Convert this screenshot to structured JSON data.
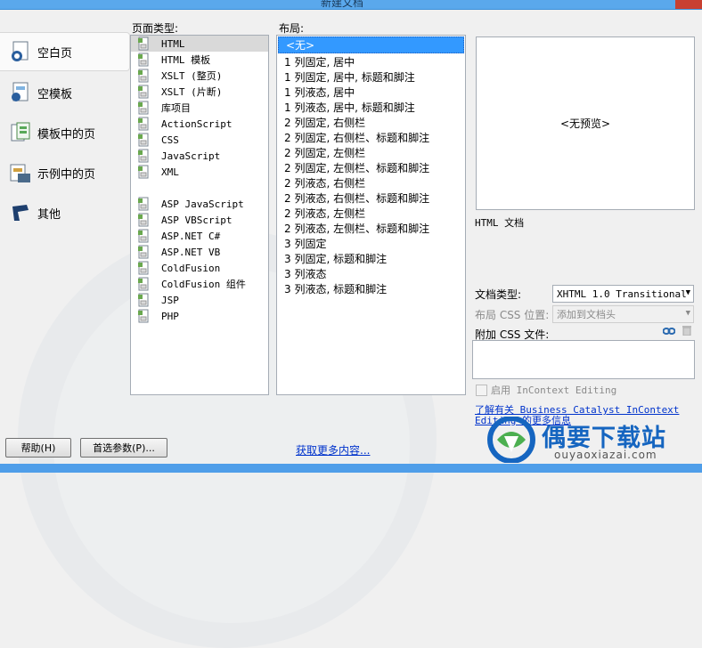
{
  "window": {
    "title": "新建文档"
  },
  "sidebar": {
    "items": [
      {
        "label": "空白页",
        "icon": "blank-page-icon"
      },
      {
        "label": "空模板",
        "icon": "empty-template-icon"
      },
      {
        "label": "模板中的页",
        "icon": "page-from-template-icon"
      },
      {
        "label": "示例中的页",
        "icon": "page-from-sample-icon"
      },
      {
        "label": "其他",
        "icon": "other-icon"
      }
    ]
  },
  "page_type": {
    "label": "页面类型:",
    "items": [
      "HTML",
      "HTML 模板",
      "XSLT (整页)",
      "XSLT (片断)",
      "库项目",
      "ActionScript",
      "CSS",
      "JavaScript",
      "XML",
      "",
      "ASP JavaScript",
      "ASP VBScript",
      "ASP.NET C#",
      "ASP.NET VB",
      "ColdFusion",
      "ColdFusion 组件",
      "JSP",
      "PHP"
    ]
  },
  "layout": {
    "label": "布局:",
    "items": [
      "<无>",
      "1 列固定, 居中",
      "1 列固定, 居中, 标题和脚注",
      "1 列液态, 居中",
      "1 列液态, 居中, 标题和脚注",
      "2 列固定, 右侧栏",
      "2 列固定, 右侧栏、标题和脚注",
      "2 列固定, 左侧栏",
      "2 列固定, 左侧栏、标题和脚注",
      "2 列液态, 右侧栏",
      "2 列液态, 右侧栏、标题和脚注",
      "2 列液态, 左侧栏",
      "2 列液态, 左侧栏、标题和脚注",
      "3 列固定",
      "3 列固定, 标题和脚注",
      "3 列液态",
      "3 列液态, 标题和脚注"
    ]
  },
  "preview": {
    "text": "<无预览>",
    "description": "HTML 文档"
  },
  "doc_type": {
    "label": "文档类型:",
    "value": "XHTML 1.0 Transitional"
  },
  "css_position": {
    "label": "布局 CSS 位置:",
    "value": "添加到文档头"
  },
  "attach_css": {
    "label": "附加 CSS 文件:"
  },
  "incontext": {
    "label": "启用 InContext Editing"
  },
  "learn_more": {
    "line1": "了解有关 Business Catalyst InContext",
    "line2": "Editing 的更多信息"
  },
  "buttons": {
    "help": "帮助(H)",
    "prefs": "首选参数(P)...",
    "more_content": "获取更多内容..."
  },
  "watermark": {
    "brand": "偶要下载站",
    "domain": "ouyaoxiazai.com"
  }
}
